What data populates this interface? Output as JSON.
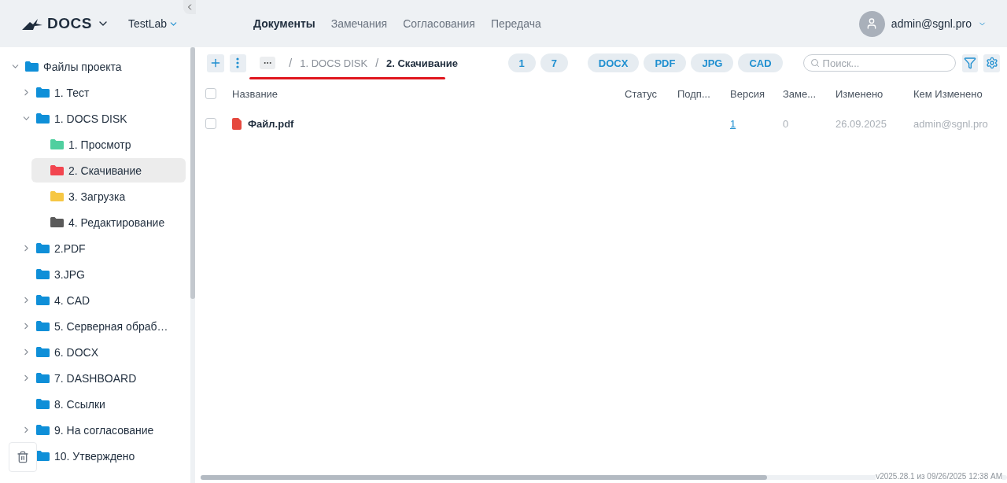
{
  "header": {
    "logo": "DOCS",
    "project": "TestLab",
    "nav": [
      {
        "label": "Документы",
        "selected": true
      },
      {
        "label": "Замечания",
        "selected": false
      },
      {
        "label": "Согласования",
        "selected": false
      },
      {
        "label": "Передача",
        "selected": false
      }
    ],
    "user": "admin@sgnl.pro"
  },
  "sidebar": {
    "tree": [
      {
        "label": "Файлы проекта",
        "color": "#0f8fd8",
        "selected": false,
        "expanded": true,
        "children": [
          {
            "label": "1. Тест",
            "color": "#0f8fd8",
            "selected": false,
            "expanded": false
          },
          {
            "label": "1. DOCS DISK",
            "color": "#0f8fd8",
            "selected": false,
            "expanded": true,
            "children": [
              {
                "label": "1. Просмотр",
                "color": "#4fcf9f",
                "selected": false
              },
              {
                "label": "2. Скачивание",
                "color": "#f2454f",
                "selected": true
              },
              {
                "label": "3. Загрузка",
                "color": "#f6c744",
                "selected": false
              },
              {
                "label": "4. Редактирование",
                "color": "#5a5a5a",
                "selected": false
              }
            ]
          },
          {
            "label": "2.PDF",
            "color": "#0f8fd8",
            "selected": false,
            "expanded": false
          },
          {
            "label": "3.JPG",
            "color": "#0f8fd8",
            "selected": false
          },
          {
            "label": "4. CAD",
            "color": "#0f8fd8",
            "selected": false,
            "expanded": false
          },
          {
            "label": "5. Серверная обраб…",
            "color": "#0f8fd8",
            "selected": false,
            "expanded": false
          },
          {
            "label": "6. DOCX",
            "color": "#0f8fd8",
            "selected": false,
            "expanded": false
          },
          {
            "label": "7. DASHBOARD",
            "color": "#0f8fd8",
            "selected": false,
            "expanded": false
          },
          {
            "label": "8. Ссылки",
            "color": "#0f8fd8",
            "selected": false
          },
          {
            "label": "9. На согласование",
            "color": "#0f8fd8",
            "selected": false,
            "expanded": false
          },
          {
            "label": "10. Утверждено",
            "color": "#0f8fd8",
            "selected": false
          }
        ]
      }
    ]
  },
  "toolbar": {
    "separator": "/",
    "breadcrumb": [
      "1. DOCS DISK",
      "2. Скачивание"
    ],
    "counts": [
      "1",
      "7"
    ],
    "filters": [
      "DOCX",
      "PDF",
      "JPG",
      "CAD"
    ],
    "search": {
      "placeholder": "Поиск..."
    }
  },
  "table": {
    "all_checked": false,
    "columns": [
      "Название",
      "Статус",
      "Подп...",
      "Версия",
      "Заме...",
      "Изменено",
      "Кем Изменено"
    ],
    "rows": [
      {
        "checked": false,
        "name": "Файл.pdf",
        "version": "1",
        "remarks": "0",
        "modified": "26.09.2025",
        "modified_by": "admin@sgnl.pro"
      }
    ]
  },
  "footer": {
    "version": "v2025.28.1 из 09/26/2025 12:38 AM"
  }
}
